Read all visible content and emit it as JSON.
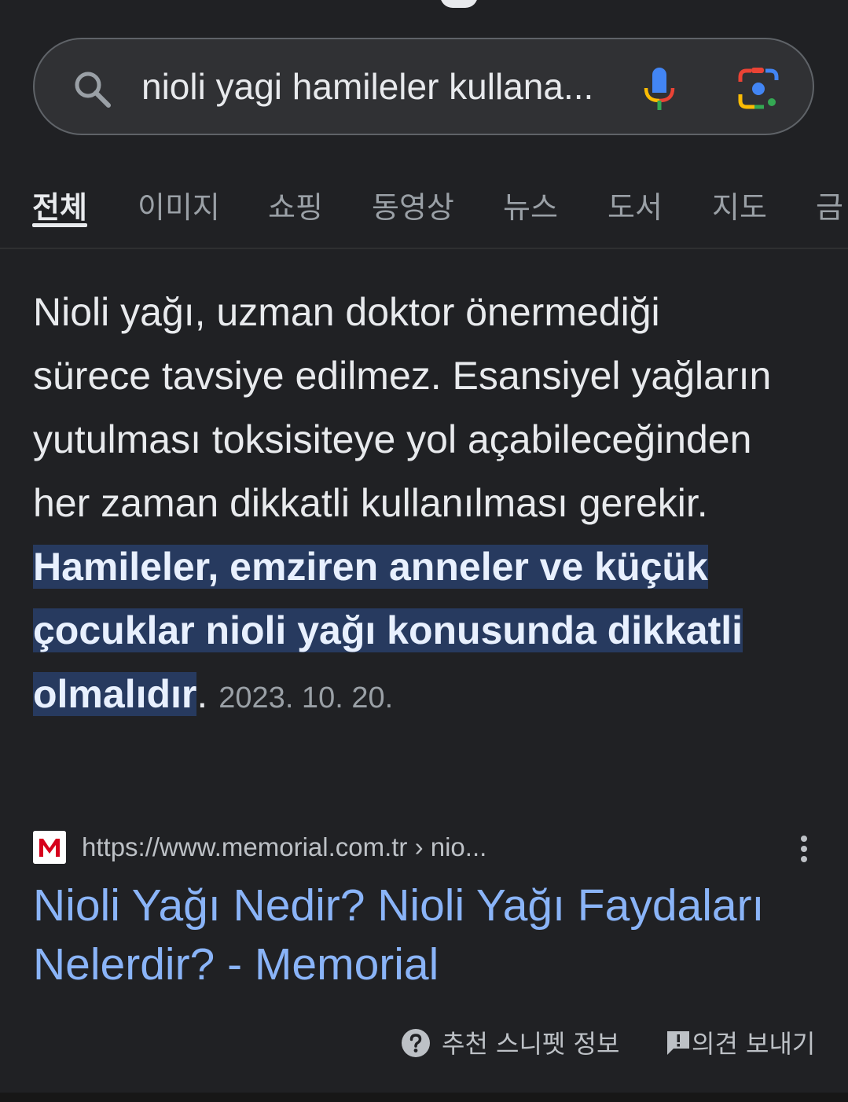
{
  "search": {
    "query": "nioli yagi hamileler kullana..."
  },
  "tabs": [
    {
      "label": "전체",
      "active": true
    },
    {
      "label": "이미지"
    },
    {
      "label": "쇼핑"
    },
    {
      "label": "동영상"
    },
    {
      "label": "뉴스"
    },
    {
      "label": "도서"
    },
    {
      "label": "지도"
    },
    {
      "label": "금"
    }
  ],
  "snippet": {
    "text": "Nioli yağı, uzman doktor önermediği sürece tavsiye edilmez. Esansiyel yağların yutulması toksisiteye yol açabileceğinden her zaman dikkatli kullanılması gerekir. ",
    "highlight": "Hamileler, emziren anneler ve küçük çocuklar nioli yağı konusunda dikkatli olmalıdır",
    "end_punct": ".",
    "date": "2023. 10. 20."
  },
  "source": {
    "favicon_letter": "M",
    "favicon_color": "#d6001c",
    "url": "https://www.memorial.com.tr › nio..."
  },
  "result": {
    "title": "Nioli Yağı Nedir? Nioli Yağı Faydaları Nelerdir? - Memorial"
  },
  "footer": {
    "about_label": "추천 스니펫 정보",
    "feedback_label": "의견 보내기"
  },
  "colors": {
    "background": "#202124",
    "link": "#8ab4f8",
    "highlight_bg": "#273a5f",
    "text": "#e8eaed",
    "muted": "#9aa0a6"
  }
}
